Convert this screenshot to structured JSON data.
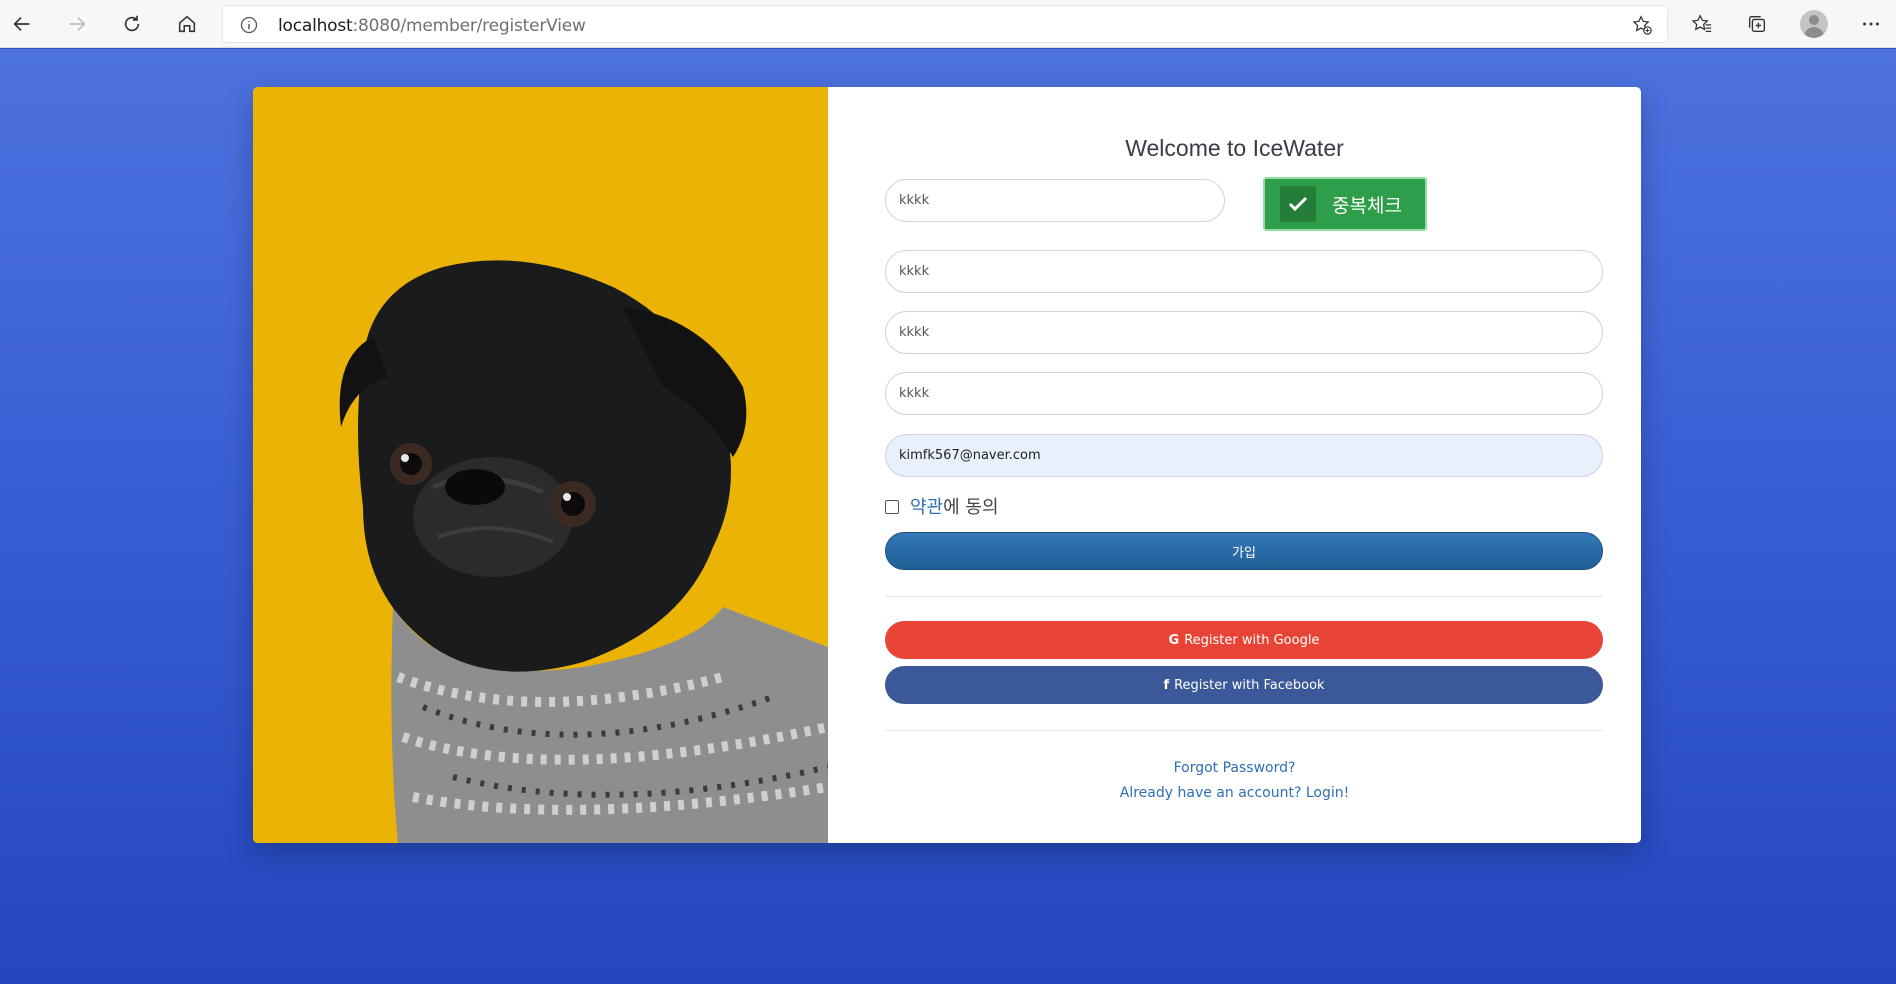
{
  "browser": {
    "url_host": "localhost",
    "url_path": ":8080/member/registerView"
  },
  "form": {
    "title": "Welcome to IceWater",
    "id_value": "kkkk",
    "duplicate_check_label": "중복체크",
    "password_value": "kkkk",
    "password_confirm_value": "kkkk",
    "name_value": "kkkk",
    "email_value": "kimfk567@naver.com",
    "agree_terms_link": "약관",
    "agree_suffix": "에 동의",
    "join_label": "가입",
    "google_label": "Register with Google",
    "facebook_label": "Register with Facebook",
    "forgot_password": "Forgot Password?",
    "login_link": "Already have an account? Login!"
  },
  "colors": {
    "background": "#2a4fc6",
    "image_panel": "#ebb306",
    "duplicate_check": "#2f9e4a",
    "join": "#2a6aa6",
    "google": "#e84436",
    "facebook": "#3b5998",
    "link": "#2f6fb6"
  },
  "icons": [
    "back-icon",
    "forward-icon",
    "refresh-icon",
    "home-icon",
    "info-icon",
    "favorite-add-icon",
    "favorites-icon",
    "collections-icon",
    "profile-icon",
    "more-icon",
    "check-icon",
    "google-icon",
    "facebook-icon"
  ]
}
